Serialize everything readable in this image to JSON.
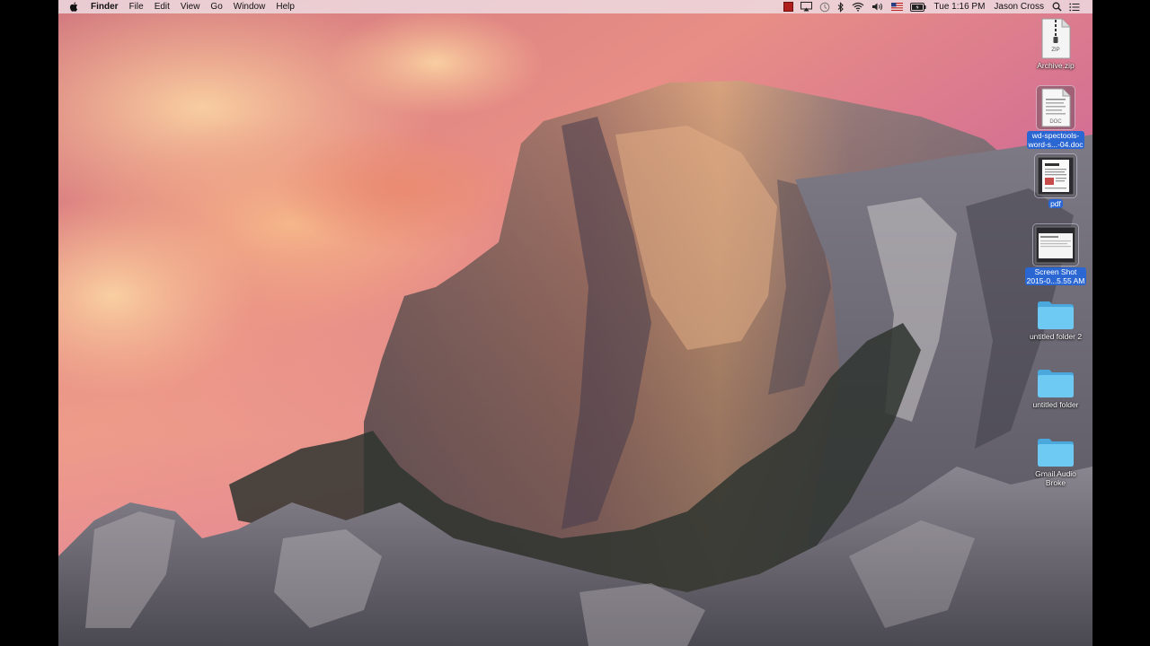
{
  "menubar": {
    "app_name": "Finder",
    "menus": [
      "File",
      "Edit",
      "View",
      "Go",
      "Window",
      "Help"
    ],
    "status_icons": [
      "record-icon",
      "airplay-icon",
      "time-machine-icon",
      "bluetooth-icon",
      "wifi-icon",
      "volume-icon",
      "flag-icon",
      "battery-icon"
    ],
    "clock": "Tue 1:16 PM",
    "user": "Jason Cross"
  },
  "desktop": {
    "icons": [
      {
        "kind": "zip",
        "lines": [
          "Archive.zip"
        ],
        "selected": false,
        "zip_badge": "ZIP"
      },
      {
        "kind": "doc",
        "lines": [
          "wd-spectools-",
          "word-s...-04.doc"
        ],
        "selected": true
      },
      {
        "kind": "pdf",
        "lines": [
          "pdf"
        ],
        "selected": true
      },
      {
        "kind": "screenshot",
        "lines": [
          "Screen Shot",
          "2015-0...5.55 AM"
        ],
        "selected": true
      },
      {
        "kind": "folder",
        "lines": [
          "untitled folder 2"
        ],
        "selected": false
      },
      {
        "kind": "folder",
        "lines": [
          "untitled folder"
        ],
        "selected": false
      },
      {
        "kind": "folder",
        "lines": [
          "Gmail Audio",
          "Broke"
        ],
        "selected": false
      }
    ]
  },
  "colors": {
    "folder": "#5fc1ee",
    "selection": "#2b67d3",
    "sky_top": "#c85a7a",
    "sky_warm": "#f2a07a",
    "rock": "#6f6a70"
  }
}
